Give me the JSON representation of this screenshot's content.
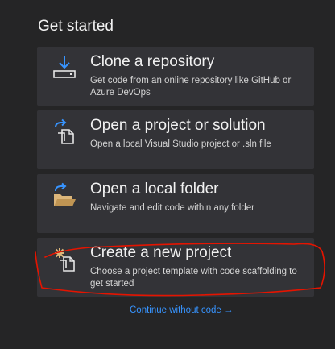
{
  "heading": "Get started",
  "cards": [
    {
      "title": "Clone a repository",
      "description": "Get code from an online repository like GitHub or Azure DevOps",
      "icon": "download-icon"
    },
    {
      "title": "Open a project or solution",
      "description": "Open a local Visual Studio project or .sln file",
      "icon": "open-project-icon"
    },
    {
      "title": "Open a local folder",
      "description": "Navigate and edit code within any folder",
      "icon": "open-folder-icon"
    },
    {
      "title": "Create a new project",
      "description": "Choose a project template with code scaffolding to get started",
      "icon": "new-project-icon"
    }
  ],
  "continue_link": "Continue without code →",
  "colors": {
    "background": "#252526",
    "card": "#333337",
    "link": "#3794ff",
    "icon_blue": "#3794ff",
    "folder_yellow": "#dcb67a",
    "annotation_red": "#e51400"
  }
}
